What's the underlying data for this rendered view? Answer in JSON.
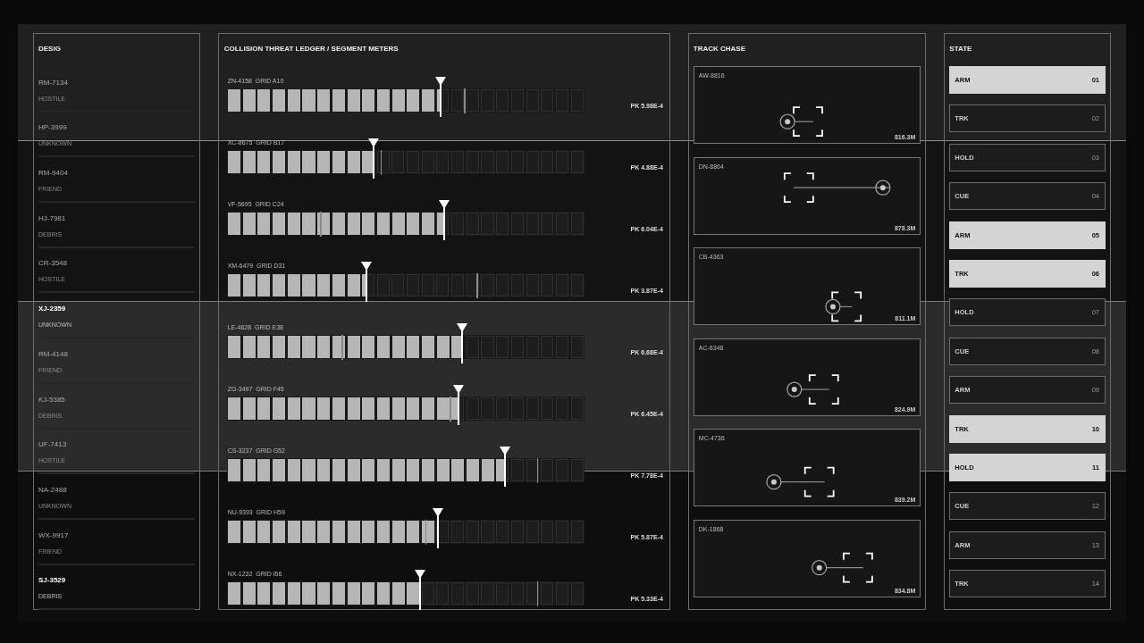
{
  "designations": {
    "title": "DESIG",
    "items": [
      {
        "name": "RM-7134",
        "class": "HOSTILE",
        "selected": false
      },
      {
        "name": "HP-3999",
        "class": "UNKNOWN",
        "selected": false
      },
      {
        "name": "RM-9404",
        "class": "FRIEND",
        "selected": false
      },
      {
        "name": "HJ-7981",
        "class": "DEBRIS",
        "selected": false
      },
      {
        "name": "CR-3548",
        "class": "HOSTILE",
        "selected": false
      },
      {
        "name": "XJ-2359",
        "class": "UNKNOWN",
        "selected": true
      },
      {
        "name": "RM-4148",
        "class": "FRIEND",
        "selected": false
      },
      {
        "name": "KJ-5385",
        "class": "DEBRIS",
        "selected": false
      },
      {
        "name": "UF-7413",
        "class": "HOSTILE",
        "selected": false
      },
      {
        "name": "NA-2488",
        "class": "UNKNOWN",
        "selected": false
      },
      {
        "name": "WX-9917",
        "class": "FRIEND",
        "selected": false
      },
      {
        "name": "SJ-3529",
        "class": "DEBRIS",
        "selected": true
      }
    ]
  },
  "ledger": {
    "title": "COLLISION THREAT LEDGER / SEGMENT METERS",
    "meters": [
      {
        "label": "ZN-4158  GRID A10",
        "level": 0.6,
        "peak": {
          "level": 0.665
        },
        "reading": "PK 5.98E-4"
      },
      {
        "label": "XC-8675  GRID B17",
        "level": 0.41,
        "peak": {
          "level": 0.43
        },
        "reading": "PK 4.88E-4"
      },
      {
        "label": "VF-5695  GRID C24",
        "level": 0.61,
        "peak": {
          "level": 0.26
        },
        "reading": "PK 6.04E-4"
      },
      {
        "label": "XM-6479  GRID D31",
        "level": 0.39,
        "peak": {
          "level": 0.7
        },
        "reading": "PK 3.87E-4"
      },
      {
        "label": "LE-4628  GRID E38",
        "level": 0.66,
        "peak": {
          "level": 0.32
        },
        "reading": "PK 6.68E-4"
      },
      {
        "label": "ZG-3497  GRID F45",
        "level": 0.65,
        "peak": {
          "level": 0.625
        },
        "reading": "PK 6.45E-4"
      },
      {
        "label": "CS-3237  GRID G52",
        "level": 0.78,
        "peak": {
          "level": 0.87
        },
        "reading": "PK 7.78E-4"
      },
      {
        "label": "NU-9393  GRID H59",
        "level": 0.59,
        "peak": {
          "level": 0.555
        },
        "reading": "PK 5.87E-4"
      },
      {
        "label": "NX-1232  GRID I66",
        "level": 0.54,
        "peak": {
          "level": 0.87
        },
        "reading": "PK 5.33E-4"
      }
    ]
  },
  "track_chase": {
    "title": "TRACK CHASE",
    "tracks": [
      {
        "id": "AW-8816",
        "range": "816.3M"
      },
      {
        "id": "DN-8864",
        "range": "878.3M"
      },
      {
        "id": "CB-4363",
        "range": "811.1M"
      },
      {
        "id": "AC-6348",
        "range": "824.9M"
      },
      {
        "id": "MC-4736",
        "range": "839.2M"
      },
      {
        "id": "DK-1868",
        "range": "834.8M"
      }
    ]
  },
  "state": {
    "title": "STATE",
    "items": [
      {
        "label": "ARM",
        "number": "01",
        "on": true
      },
      {
        "label": "TRK",
        "number": "02",
        "on": false
      },
      {
        "label": "HOLD",
        "number": "03",
        "on": false
      },
      {
        "label": "CUE",
        "number": "04",
        "on": false
      },
      {
        "label": "ARM",
        "number": "05",
        "on": true
      },
      {
        "label": "TRK",
        "number": "06",
        "on": true
      },
      {
        "label": "HOLD",
        "number": "07",
        "on": false
      },
      {
        "label": "CUE",
        "number": "08",
        "on": false
      },
      {
        "label": "ARM",
        "number": "09",
        "on": false
      },
      {
        "label": "TRK",
        "number": "10",
        "on": true
      },
      {
        "label": "HOLD",
        "number": "11",
        "on": true
      },
      {
        "label": "CUE",
        "number": "12",
        "on": false
      },
      {
        "label": "ARM",
        "number": "13",
        "on": false
      },
      {
        "label": "TRK",
        "number": "14",
        "on": false
      }
    ]
  }
}
